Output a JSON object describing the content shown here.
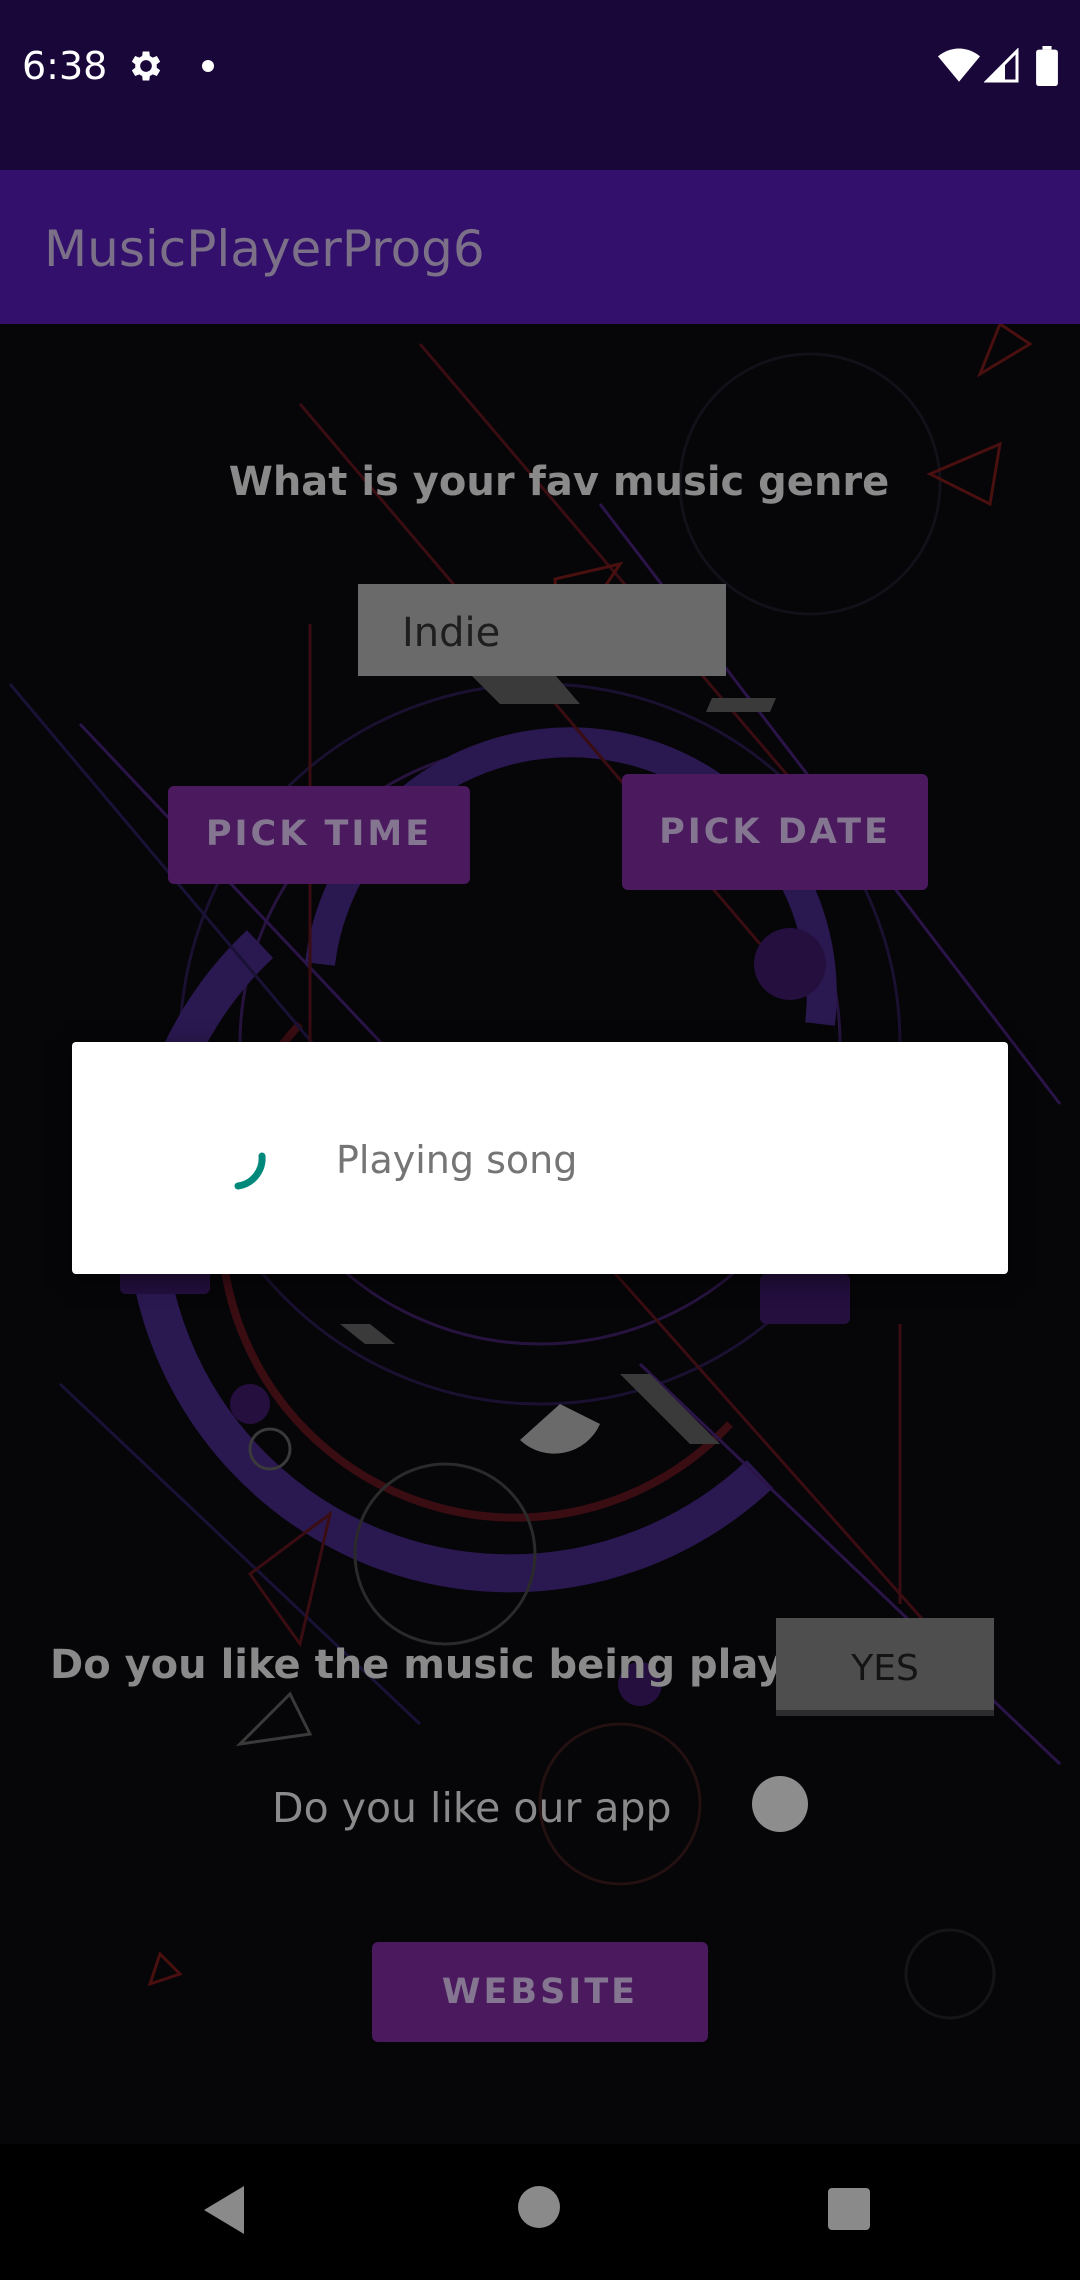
{
  "status_bar": {
    "time": "6:38",
    "icons": [
      "gear-icon",
      "notification-dot-icon",
      "wifi-icon",
      "signal-icon",
      "battery-icon"
    ]
  },
  "app_bar": {
    "title": "MusicPlayerProg6",
    "color": "#32106b"
  },
  "main": {
    "genre_question": "What is your fav music genre",
    "genre_selected": "Indie",
    "pick_time_label": "PICK TIME",
    "pick_date_label": "PICK DATE",
    "like_music_question": "Do you like the music being played",
    "like_music_toggle": "YES",
    "like_app_question": "Do you like our app",
    "website_label": "WEBSITE",
    "button_color": "#4b1a5e"
  },
  "progress_dialog": {
    "message": "Playing song",
    "spinner_color": "#00897b"
  },
  "nav_bar": {
    "icons": [
      "back-icon",
      "home-icon",
      "recents-icon"
    ]
  }
}
